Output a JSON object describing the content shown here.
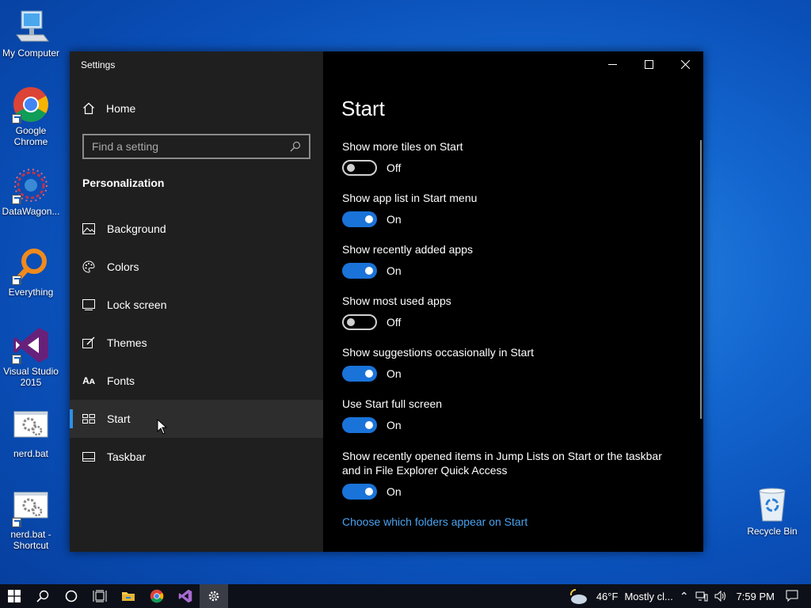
{
  "desktop": {
    "icons": [
      {
        "label": "My Computer"
      },
      {
        "label": "Google Chrome"
      },
      {
        "label": "DataWagon..."
      },
      {
        "label": "Everything"
      },
      {
        "label": "Visual Studio 2015"
      },
      {
        "label": "nerd.bat"
      },
      {
        "label": "nerd.bat - Shortcut"
      },
      {
        "label": "Recycle Bin"
      }
    ]
  },
  "window": {
    "title": "Settings",
    "home_label": "Home",
    "search_placeholder": "Find a setting",
    "section_title": "Personalization",
    "nav": [
      {
        "label": "Background",
        "icon": "picture-icon"
      },
      {
        "label": "Colors",
        "icon": "palette-icon"
      },
      {
        "label": "Lock screen",
        "icon": "lock-screen-icon"
      },
      {
        "label": "Themes",
        "icon": "themes-icon"
      },
      {
        "label": "Fonts",
        "icon": "fonts-icon"
      },
      {
        "label": "Start",
        "icon": "start-icon",
        "active": true
      },
      {
        "label": "Taskbar",
        "icon": "taskbar-icon"
      }
    ]
  },
  "content": {
    "title": "Start",
    "settings": [
      {
        "label": "Show more tiles on Start",
        "state": "Off"
      },
      {
        "label": "Show app list in Start menu",
        "state": "On"
      },
      {
        "label": "Show recently added apps",
        "state": "On"
      },
      {
        "label": "Show most used apps",
        "state": "Off"
      },
      {
        "label": "Show suggestions occasionally in Start",
        "state": "On"
      },
      {
        "label": "Use Start full screen",
        "state": "On"
      },
      {
        "label": "Show recently opened items in Jump Lists on Start or the taskbar and in File Explorer Quick Access",
        "state": "On"
      }
    ],
    "link": "Choose which folders appear on Start"
  },
  "taskbar": {
    "weather_temp": "46°F",
    "weather_text": "Mostly cl...",
    "time": "7:59 PM"
  },
  "colors": {
    "accent": "#1a73d9",
    "link": "#4aa3f0",
    "sidebar_bg": "#1f1f1f",
    "content_bg": "#000000"
  }
}
